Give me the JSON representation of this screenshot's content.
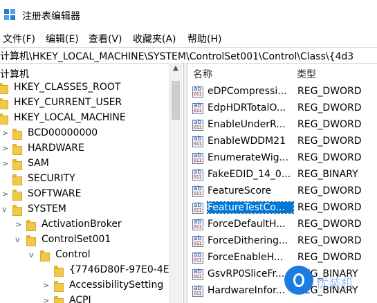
{
  "window": {
    "title": "注册表编辑器",
    "icon": "regedit-icon"
  },
  "menu": [
    "文件(F)",
    "编辑(E)",
    "查看(V)",
    "收藏夹(A)",
    "帮助(H)"
  ],
  "address": "计算机\\HKEY_LOCAL_MACHINE\\SYSTEM\\ControlSet001\\Control\\Class\\{4d3",
  "tree": {
    "root": "计算机",
    "items": [
      {
        "label": "HKEY_CLASSES_ROOT",
        "expander": ""
      },
      {
        "label": "HKEY_CURRENT_USER",
        "expander": ""
      },
      {
        "label": "HKEY_LOCAL_MACHINE",
        "expander": ""
      },
      {
        "label": "BCD00000000",
        "expander": ">"
      },
      {
        "label": "HARDWARE",
        "expander": ">"
      },
      {
        "label": "SAM",
        "expander": ">"
      },
      {
        "label": "SECURITY",
        "expander": ""
      },
      {
        "label": "SOFTWARE",
        "expander": ">"
      },
      {
        "label": "SYSTEM",
        "expander": "v"
      },
      {
        "label": "ActivationBroker",
        "expander": ">"
      },
      {
        "label": "ControlSet001",
        "expander": "v"
      },
      {
        "label": "Control",
        "expander": "v"
      },
      {
        "label": "{7746D80F-97E0-4E",
        "expander": ""
      },
      {
        "label": "AccessibilitySetting",
        "expander": ">"
      },
      {
        "label": "ACPI",
        "expander": ">"
      }
    ]
  },
  "list": {
    "columns": {
      "name": "名称",
      "type": "类型"
    },
    "rows": [
      {
        "name": "eDPCompressi...",
        "type": "REG_DWORD"
      },
      {
        "name": "EdpHDRTotalO...",
        "type": "REG_DWORD"
      },
      {
        "name": "EnableUnderR...",
        "type": "REG_DWORD"
      },
      {
        "name": "EnableWDDM21",
        "type": "REG_DWORD"
      },
      {
        "name": "EnumerateWig...",
        "type": "REG_DWORD"
      },
      {
        "name": "FakeEDID_14_0...",
        "type": "REG_BINARY"
      },
      {
        "name": "FeatureScore",
        "type": "REG_DWORD"
      },
      {
        "name": "FeatureTestCo...",
        "type": "REG_DWORD",
        "selected": true
      },
      {
        "name": "ForceDefaultH...",
        "type": "REG_DWORD"
      },
      {
        "name": "ForceDithering...",
        "type": "REG_DWORD"
      },
      {
        "name": "ForceEnableH...",
        "type": "REG_DWORD"
      },
      {
        "name": "GsvRP0SliceFr...",
        "type": "REG_BINARY"
      },
      {
        "name": "HardwareInfor...",
        "type": "REG_BINARY"
      }
    ]
  },
  "watermark": {
    "text": "优装机"
  },
  "colors": {
    "selection": "#0078d7",
    "folder": "#f2c84b"
  }
}
